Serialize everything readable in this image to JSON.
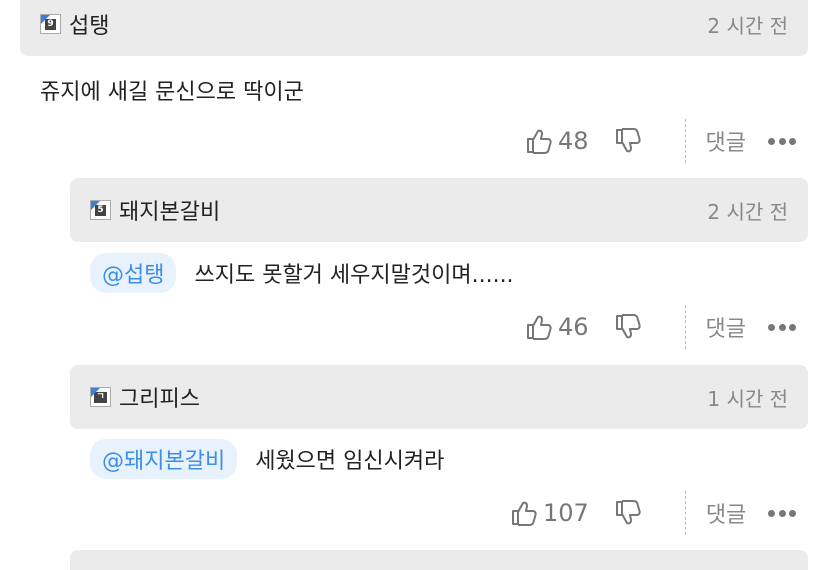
{
  "comments": [
    {
      "level": "9",
      "user": "섭탱",
      "time": "2 시간 전",
      "mention": "",
      "text": "쥬지에 새길 문신으로 딱이군",
      "likes": "48",
      "reply_label": "댓글"
    },
    {
      "level": "5",
      "user": "돼지본갈비",
      "time": "2 시간 전",
      "mention": "@섭탱",
      "text": "쓰지도 못할거 세우지말것이며......",
      "likes": "46",
      "reply_label": "댓글"
    },
    {
      "level": "ㄱ",
      "user": "그리피스",
      "time": "1 시간 전",
      "mention": "@돼지본갈비",
      "text": "세웠으면 임신시켜라",
      "likes": "107",
      "reply_label": "댓글"
    }
  ],
  "icons": {
    "like": "thumbs-up-icon",
    "dislike": "thumbs-down-icon",
    "more": "more-dots-icon"
  },
  "colors": {
    "header_bg": "#ebebeb",
    "mention_bg": "#e8f2fc",
    "mention_text": "#3d8ee8",
    "muted_text": "#888888"
  }
}
